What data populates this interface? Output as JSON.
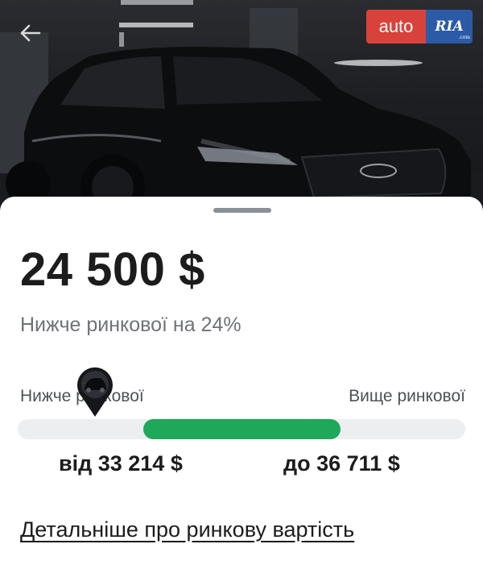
{
  "header": {
    "back_icon": "arrow-left-icon",
    "logo": {
      "part1": "auto",
      "part2": "RIA",
      "part2_sub": ".com",
      "colors": {
        "auto": "#d9423b",
        "ria": "#2b5aa7"
      }
    }
  },
  "listing": {
    "price": "24 500 $",
    "price_note": "Нижче ринкової на 24%"
  },
  "market_range": {
    "label_low": "Нижче ринкової",
    "label_high": "Вище ринкової",
    "from": "від 33 214 $",
    "to": "до 36 711 $",
    "marker_icon": "car-location-pin-icon",
    "colors": {
      "fill": "#1fa85a",
      "track": "#eceef0"
    }
  },
  "details_link": "Детальніше про ринкову вартість"
}
